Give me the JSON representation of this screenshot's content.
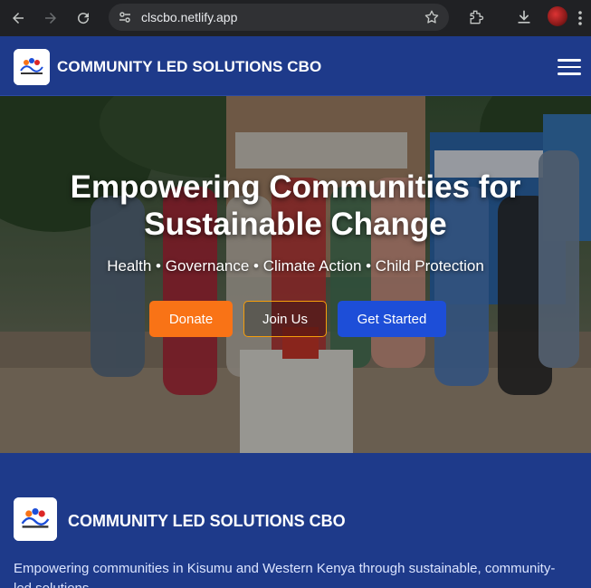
{
  "browser": {
    "url": "clscbo.netlify.app",
    "icons": [
      "back-arrow-icon",
      "forward-arrow-icon",
      "reload-icon",
      "site-info-icon",
      "bookmark-star-icon",
      "extensions-icon",
      "download-icon",
      "profile-avatar",
      "more-menu-icon"
    ]
  },
  "header": {
    "brand": "COMMUNITY LED SOLUTIONS CBO",
    "menu_icon": "hamburger-menu-icon"
  },
  "hero": {
    "title_line1": "Empowering Communities for",
    "title_line2": "Sustainable Change",
    "subtitle": "Health • Governance • Climate Action • Child Protection",
    "buttons": {
      "donate": "Donate",
      "join": "Join Us",
      "start": "Get Started"
    }
  },
  "about": {
    "title": "COMMUNITY LED SOLUTIONS CBO",
    "text": "Empowering communities in Kisumu and Western Kenya through sustainable, community-led solutions."
  },
  "colors": {
    "primary": "#1e3a8a",
    "donate": "#f97316",
    "join_border": "#f59e0b",
    "get_started": "#1d4ed8"
  }
}
